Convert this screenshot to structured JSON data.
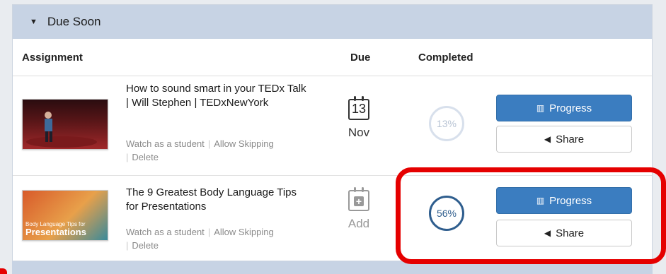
{
  "section": {
    "title": "Due Soon",
    "caret_icon": "caret-down-icon"
  },
  "columns": {
    "assignment": "Assignment",
    "due": "Due",
    "completed": "Completed"
  },
  "assignments": [
    {
      "title": "How to sound smart in your TEDx Talk | Will Stephen | TEDxNewYork",
      "actions": {
        "watch": "Watch as a student",
        "skip": "Allow Skipping",
        "delete": "Delete"
      },
      "due": {
        "day": "13",
        "month": "Nov"
      },
      "completed": "13%",
      "progress_label": "Progress",
      "share_label": "Share"
    },
    {
      "title": "The 9 Greatest Body Language Tips for Presentations",
      "thumb_text": {
        "line1": "Body Language Tips for",
        "line2": "Presentations"
      },
      "actions": {
        "watch": "Watch as a student",
        "skip": "Allow Skipping",
        "delete": "Delete"
      },
      "due": {
        "label": "Add"
      },
      "completed": "56%",
      "progress_label": "Progress",
      "share_label": "Share"
    }
  ],
  "colors": {
    "primary": "#3b7dc0",
    "header": "#c7d3e4",
    "highlight": "#e50000"
  }
}
